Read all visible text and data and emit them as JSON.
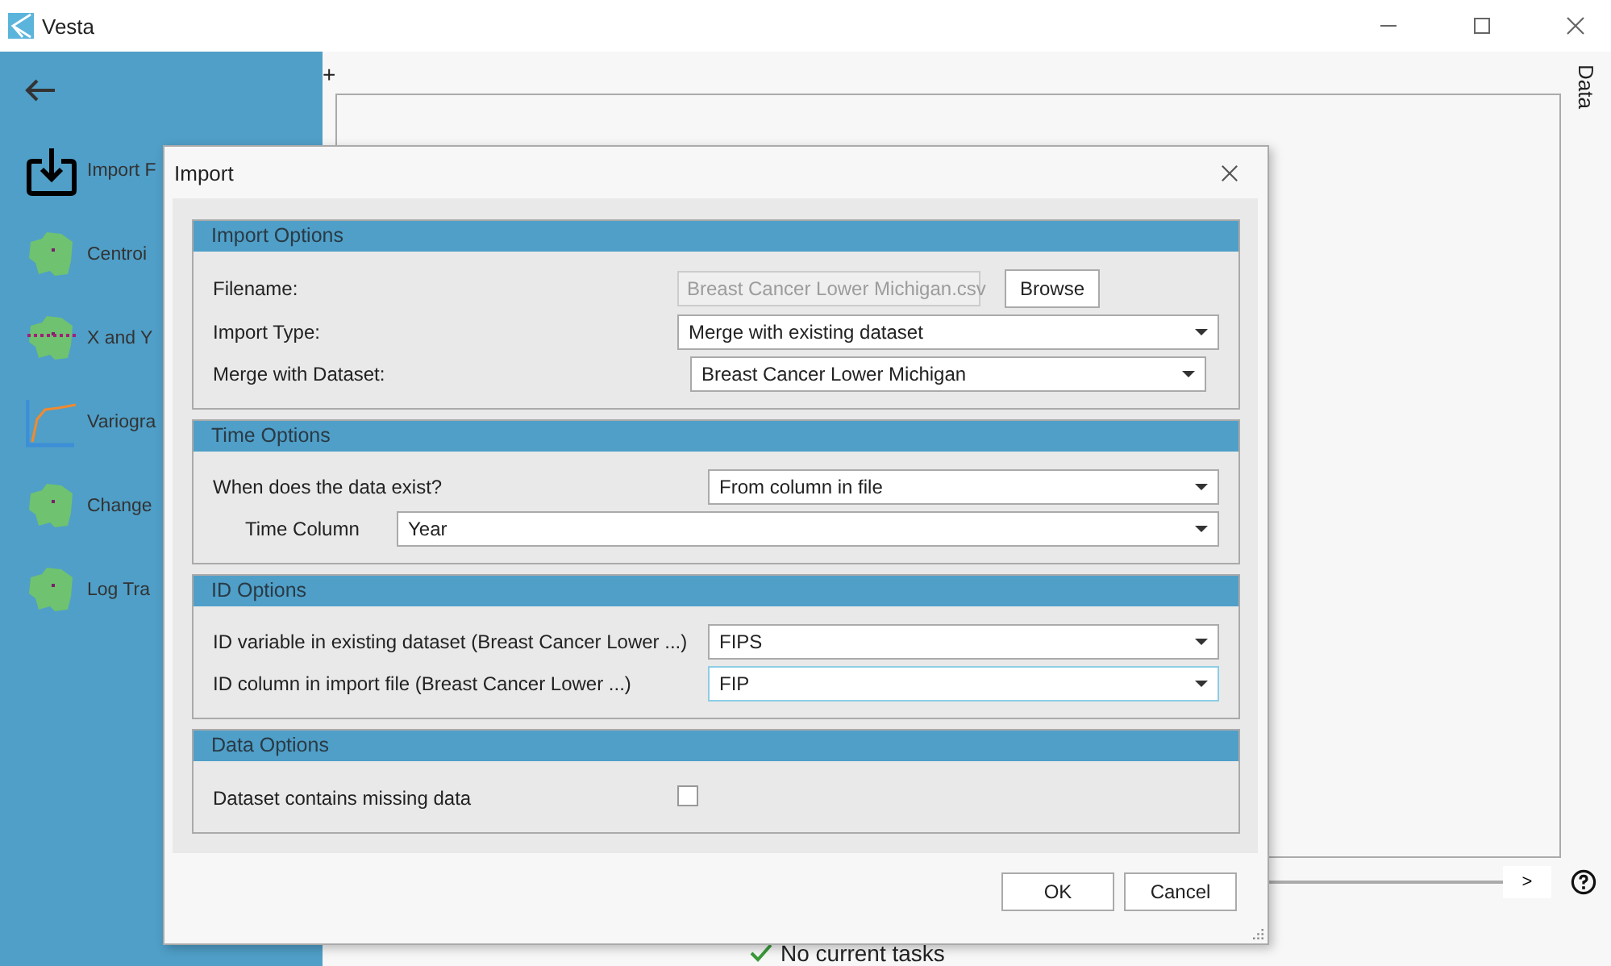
{
  "window": {
    "title": "Vesta"
  },
  "sidebar": {
    "items": [
      {
        "label": "Import F",
        "kind": "import"
      },
      {
        "label": "Centroi",
        "kind": "map"
      },
      {
        "label": "X and Y",
        "kind": "map-points"
      },
      {
        "label": "Variogra",
        "kind": "variogram"
      },
      {
        "label": "Change",
        "kind": "map"
      },
      {
        "label": "Log Tra",
        "kind": "map"
      }
    ]
  },
  "main": {
    "tab": "+",
    "side_tab": "Data",
    "next_button": ">",
    "status": "No current tasks"
  },
  "dialog": {
    "title": "Import",
    "sections": [
      {
        "title": "Import Options",
        "rows": [
          {
            "kind": "file",
            "label": "Filename:",
            "value": "Breast Cancer Lower Michigan.csv",
            "disabled": true,
            "button": "Browse"
          },
          {
            "kind": "select",
            "label": "Import Type:",
            "value": "Merge with existing dataset",
            "focused": false
          },
          {
            "kind": "select",
            "label": "Merge with Dataset:",
            "value": "Breast Cancer Lower Michigan",
            "focused": false
          }
        ]
      },
      {
        "title": "Time Options",
        "rows": [
          {
            "kind": "select",
            "label": "When does the data exist?",
            "value": "From column in file",
            "focused": false
          },
          {
            "kind": "select",
            "label": "Time Column",
            "value": "Year",
            "focused": false
          }
        ]
      },
      {
        "title": "ID Options",
        "rows": [
          {
            "kind": "select",
            "label": "ID variable in existing dataset (Breast Cancer Lower ...)",
            "value": "FIPS",
            "focused": false
          },
          {
            "kind": "select",
            "label": "ID column in import file (Breast Cancer Lower ...)",
            "value": "FIP",
            "focused": true
          }
        ]
      },
      {
        "title": "Data Options",
        "rows": [
          {
            "kind": "checkbox",
            "label": "Dataset contains missing data",
            "checked": false
          }
        ]
      }
    ],
    "buttons": [
      "OK",
      "Cancel"
    ]
  }
}
